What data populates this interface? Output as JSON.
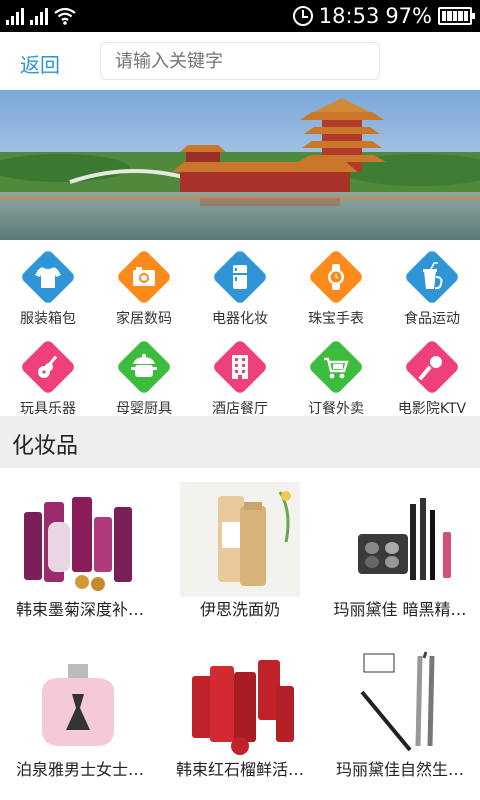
{
  "status_bar": {
    "time": "18:53",
    "battery": "97%"
  },
  "header": {
    "back_label": "返回",
    "search_placeholder": "请输入关键字"
  },
  "categories": [
    {
      "label": "服装箱包",
      "icon": "shirt-icon",
      "color": "#2f95d6"
    },
    {
      "label": "家居数码",
      "icon": "camera-icon",
      "color": "#ff8a1c"
    },
    {
      "label": "电器化妆",
      "icon": "fridge-icon",
      "color": "#2f95d6"
    },
    {
      "label": "珠宝手表",
      "icon": "watch-icon",
      "color": "#ff8a1c"
    },
    {
      "label": "食品运动",
      "icon": "drink-icon",
      "color": "#2f95d6"
    },
    {
      "label": "玩具乐器",
      "icon": "guitar-icon",
      "color": "#f0407a"
    },
    {
      "label": "母婴厨具",
      "icon": "pot-icon",
      "color": "#3dbb3d"
    },
    {
      "label": "酒店餐厅",
      "icon": "building-icon",
      "color": "#f0407a"
    },
    {
      "label": "订餐外卖",
      "icon": "delivery-icon",
      "color": "#3dbb3d"
    },
    {
      "label": "电影院KTV",
      "icon": "microphone-icon",
      "color": "#f0407a"
    }
  ],
  "section_title": "化妆品",
  "products": [
    {
      "name": "韩束墨菊深度补…"
    },
    {
      "name": "伊思洗面奶"
    },
    {
      "name": "玛丽黛佳 暗黑精…"
    },
    {
      "name": "泊泉雅男士女士…"
    },
    {
      "name": "韩束红石榴鲜活…"
    },
    {
      "name": "玛丽黛佳自然生…"
    }
  ]
}
